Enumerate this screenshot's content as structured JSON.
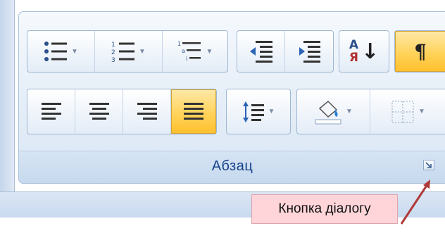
{
  "group": {
    "label": "Абзац"
  },
  "ribbon": {
    "row1": [
      {
        "name": "bullets",
        "icon": "bullet-list-icon",
        "dropdown": true
      },
      {
        "name": "numbering",
        "icon": "numbered-list-icon",
        "dropdown": true
      },
      {
        "name": "multilevel",
        "icon": "multilevel-list-icon",
        "dropdown": true
      },
      {
        "name": "decrease-indent",
        "icon": "decrease-indent-icon"
      },
      {
        "name": "increase-indent",
        "icon": "increase-indent-icon"
      },
      {
        "name": "sort",
        "icon": "sort-az-icon",
        "letters_top": "А",
        "letters_bottom": "Я"
      },
      {
        "name": "show-formatting",
        "icon": "pilcrow-icon",
        "glyph": "¶",
        "active": true
      }
    ],
    "row2": [
      {
        "name": "align-left",
        "icon": "align-left-icon"
      },
      {
        "name": "align-center",
        "icon": "align-center-icon"
      },
      {
        "name": "align-right",
        "icon": "align-right-icon"
      },
      {
        "name": "justify",
        "icon": "justify-icon",
        "active": true
      },
      {
        "name": "line-spacing",
        "icon": "line-spacing-icon",
        "dropdown": true
      },
      {
        "name": "shading",
        "icon": "paint-bucket-icon",
        "dropdown": true
      },
      {
        "name": "borders",
        "icon": "borders-icon",
        "dropdown": true
      }
    ]
  },
  "tooltip": {
    "text": "Кнопка діалогу"
  },
  "colors": {
    "accent_active": "#ffc02e",
    "group_label": "#15428b",
    "arrow": "#b03a3a"
  }
}
